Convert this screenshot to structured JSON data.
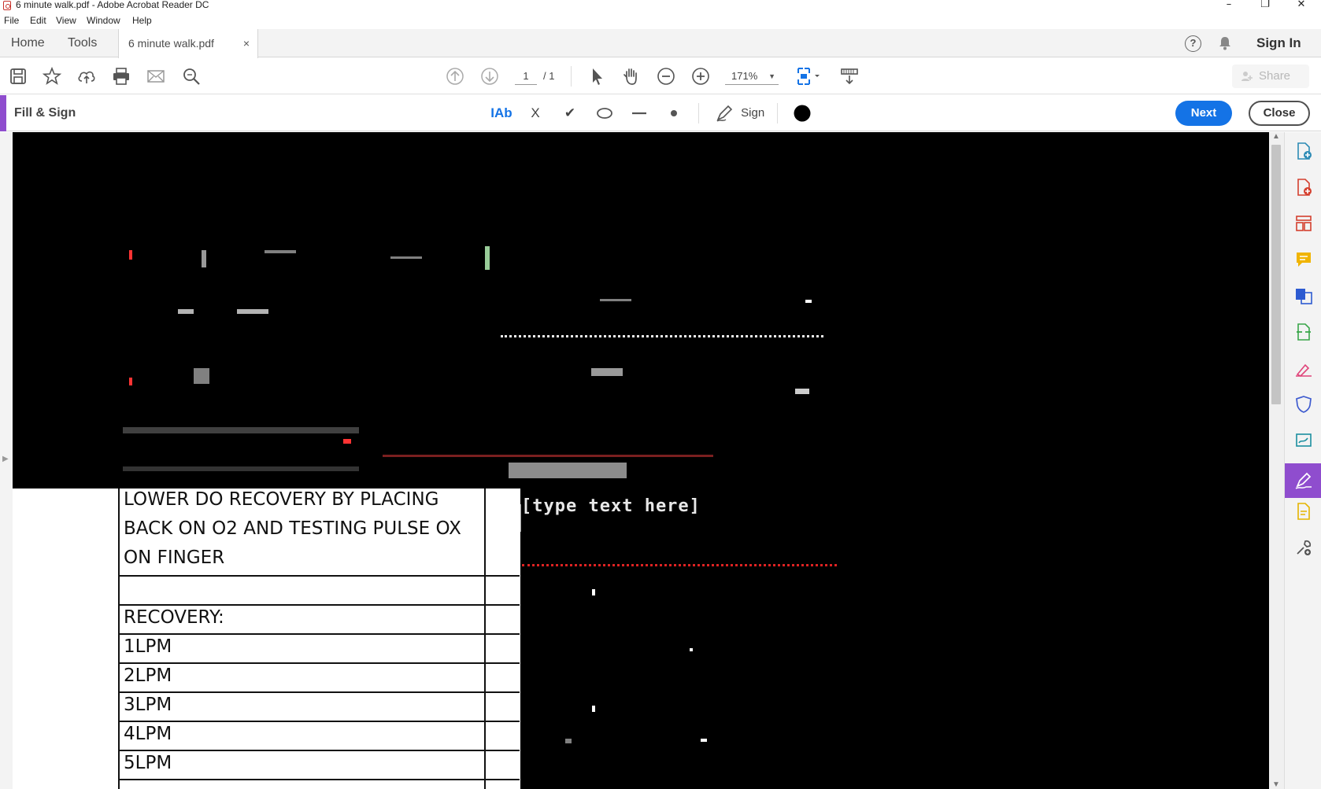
{
  "window": {
    "title": "6 minute walk.pdf - Adobe Acrobat Reader DC",
    "controls": {
      "minimize": "–",
      "restore": "❐",
      "close": "✕"
    }
  },
  "menu": [
    "File",
    "Edit",
    "View",
    "Window",
    "Help"
  ],
  "tabs": {
    "home": "Home",
    "tools": "Tools",
    "document": "6 minute walk.pdf",
    "close_glyph": "×"
  },
  "header": {
    "help_glyph": "?",
    "sign_in": "Sign In"
  },
  "toolbar": {
    "page_current": "1",
    "page_total": "/ 1",
    "zoom": "171%",
    "zoom_caret": "▼",
    "share_label": "Share"
  },
  "fill_sign": {
    "title": "Fill & Sign",
    "text_tool": "IAb",
    "cross_tool": "X",
    "check_tool": "✔",
    "sign_label": "Sign",
    "next_label": "Next",
    "close_label": "Close",
    "color": "#000000"
  },
  "document": {
    "table_rows": [
      "LOWER DO RECOVERY BY PLACING",
      "BACK ON O2 AND TESTING PULSE OX",
      "ON FINGER",
      "",
      "RECOVERY:",
      "1LPM",
      "2LPM",
      "3LPM",
      "4LPM",
      "5LPM"
    ],
    "fill_field_text": "[type text here]"
  },
  "colors": {
    "accent_purple": "#8f4dce",
    "primary_blue": "#1473e6",
    "toolbar_bg": "#f3f3f3"
  }
}
